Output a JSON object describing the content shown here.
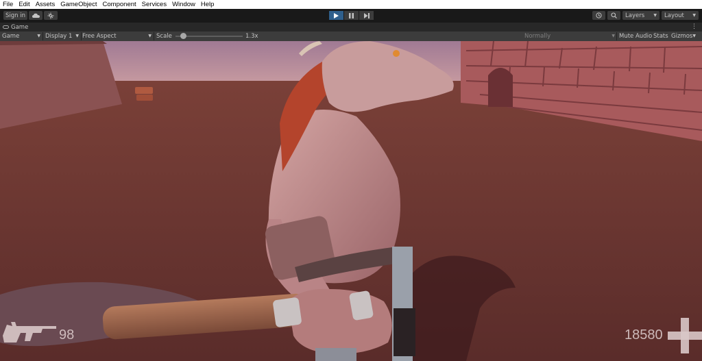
{
  "menu": {
    "items": [
      "File",
      "Edit",
      "Assets",
      "GameObject",
      "Component",
      "Services",
      "Window",
      "Help"
    ]
  },
  "toolbar": {
    "signin_label": "Sign in",
    "layers_label": "Layers",
    "layout_label": "Layout",
    "play_mode_active": true
  },
  "tab": {
    "label": "Game"
  },
  "gameview": {
    "mode": "Game",
    "display": "Display 1",
    "aspect": "Free Aspect",
    "scale_label": "Scale",
    "scale_value": "1.3x",
    "scale_fraction": 0.12,
    "play_focus": "Normally",
    "mute_audio": "Mute Audio",
    "stats": "Stats",
    "gizmos": "Gizmos"
  },
  "hud": {
    "ammo": "98",
    "score": "18580",
    "colors": {
      "hud_text": "#d9c8c8"
    }
  },
  "colors": {
    "play_active": "#2f5f8c",
    "toolbar_bg": "#191919",
    "button_bg": "#3c3c3c"
  },
  "icons": [
    "cloud-icon",
    "collab-icon",
    "play-icon",
    "pause-icon",
    "step-icon",
    "history-icon",
    "search-icon",
    "gun-icon",
    "health-plus-icon"
  ]
}
